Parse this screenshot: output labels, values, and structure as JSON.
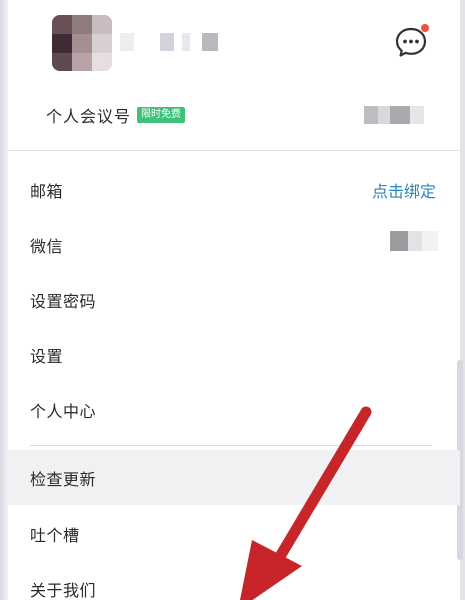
{
  "header": {
    "messages_icon": "chat-bubble-icon",
    "meeting_label": "个人会议号",
    "free_badge": "限时免费"
  },
  "menu": {
    "mailbox_label": "邮箱",
    "bind_link": "点击绑定",
    "wechat_label": "微信",
    "set_password_label": "设置密码",
    "settings_label": "设置",
    "personal_center_label": "个人中心",
    "check_update_label": "检查更新",
    "feedback_label": "吐个槽",
    "about_label": "关于我们"
  },
  "colors": {
    "link": "#2a86b6",
    "badge": "#3cc27a",
    "notification_dot": "#f0513b",
    "hover_row": "#f1f1f3",
    "annotation_arrow": "#c6262a"
  }
}
